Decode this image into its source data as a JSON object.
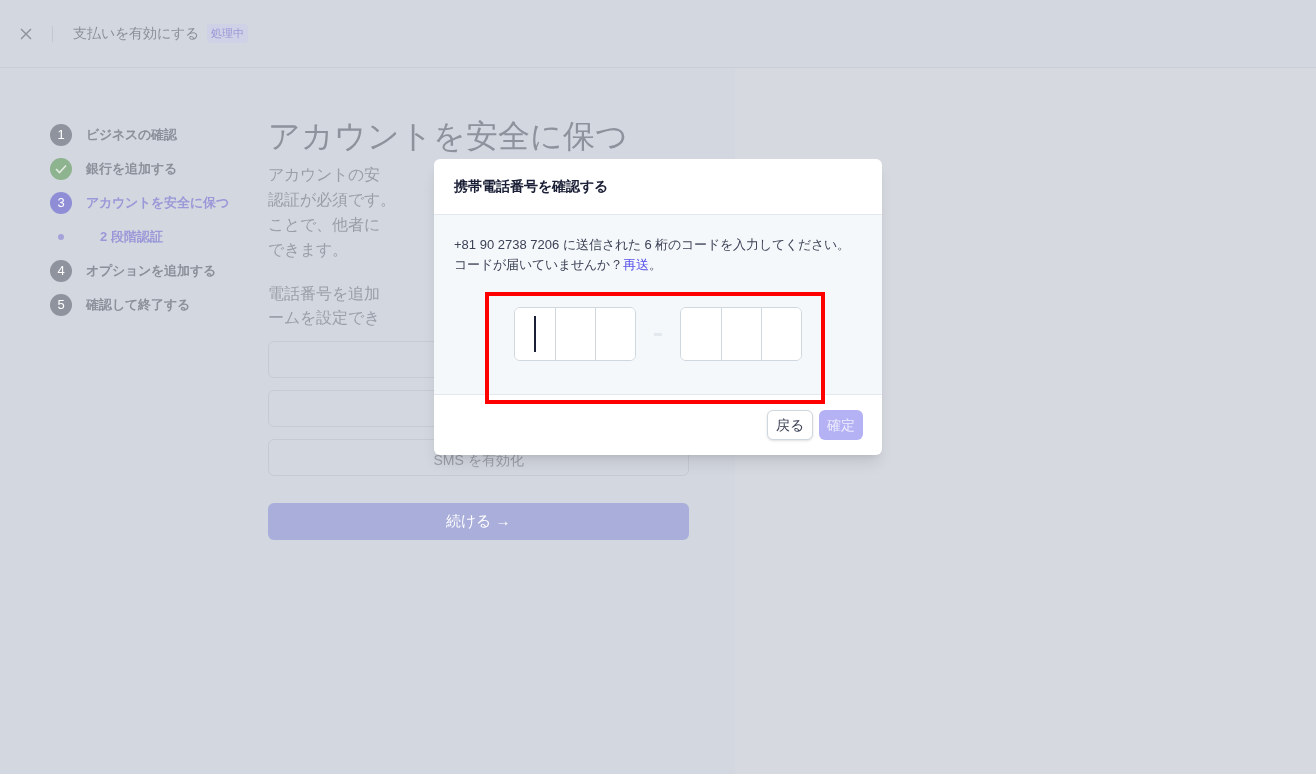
{
  "header": {
    "title": "支払いを有効にする",
    "badge": "処理中"
  },
  "steps": [
    {
      "kind": "number",
      "marker": "1",
      "label": "ビジネスの確認",
      "selected": false
    },
    {
      "kind": "done",
      "label": "銀行を追加する",
      "selected": false
    },
    {
      "kind": "number",
      "marker": "3",
      "label": "アカウントを安全に保つ",
      "selected": true
    },
    {
      "kind": "substep",
      "label": "2 段階認証",
      "selected": true
    },
    {
      "kind": "number",
      "marker": "4",
      "label": "オプションを追加する",
      "selected": false
    },
    {
      "kind": "number",
      "marker": "5",
      "label": "確認して終了する",
      "selected": false
    }
  ],
  "main": {
    "title": "アカウントを安全に保つ",
    "paragraph_1": [
      "アカウントの安",
      "認証が必須です。",
      "ことで、他者に",
      "できます。"
    ],
    "paragraph_2": [
      "電話番号を追加",
      "ームを設定でき"
    ],
    "options": [
      {
        "kind": "blank"
      },
      {
        "kind": "blank"
      },
      {
        "kind": "labeled",
        "label": "SMS を有効化"
      }
    ],
    "continue_button": "続ける →"
  },
  "dialog": {
    "title": "携帯電話番号を確認する",
    "message": "+81 90 2738 7206 に送信された 6 桁のコードを入力してください。",
    "resend_prompt": "コードが届いていませんか？",
    "resend_link": "再送",
    "resend_end": "。",
    "code_groups": [
      [
        {
          "focused": true
        },
        {
          "focused": false
        },
        {
          "focused": false
        }
      ],
      [
        {
          "focused": false
        },
        {
          "focused": false
        },
        {
          "focused": false
        }
      ]
    ],
    "buttons": [
      {
        "label": "戻る",
        "kind": "secondary",
        "disabled": false
      },
      {
        "label": "確定",
        "kind": "primary",
        "disabled": true
      }
    ]
  }
}
